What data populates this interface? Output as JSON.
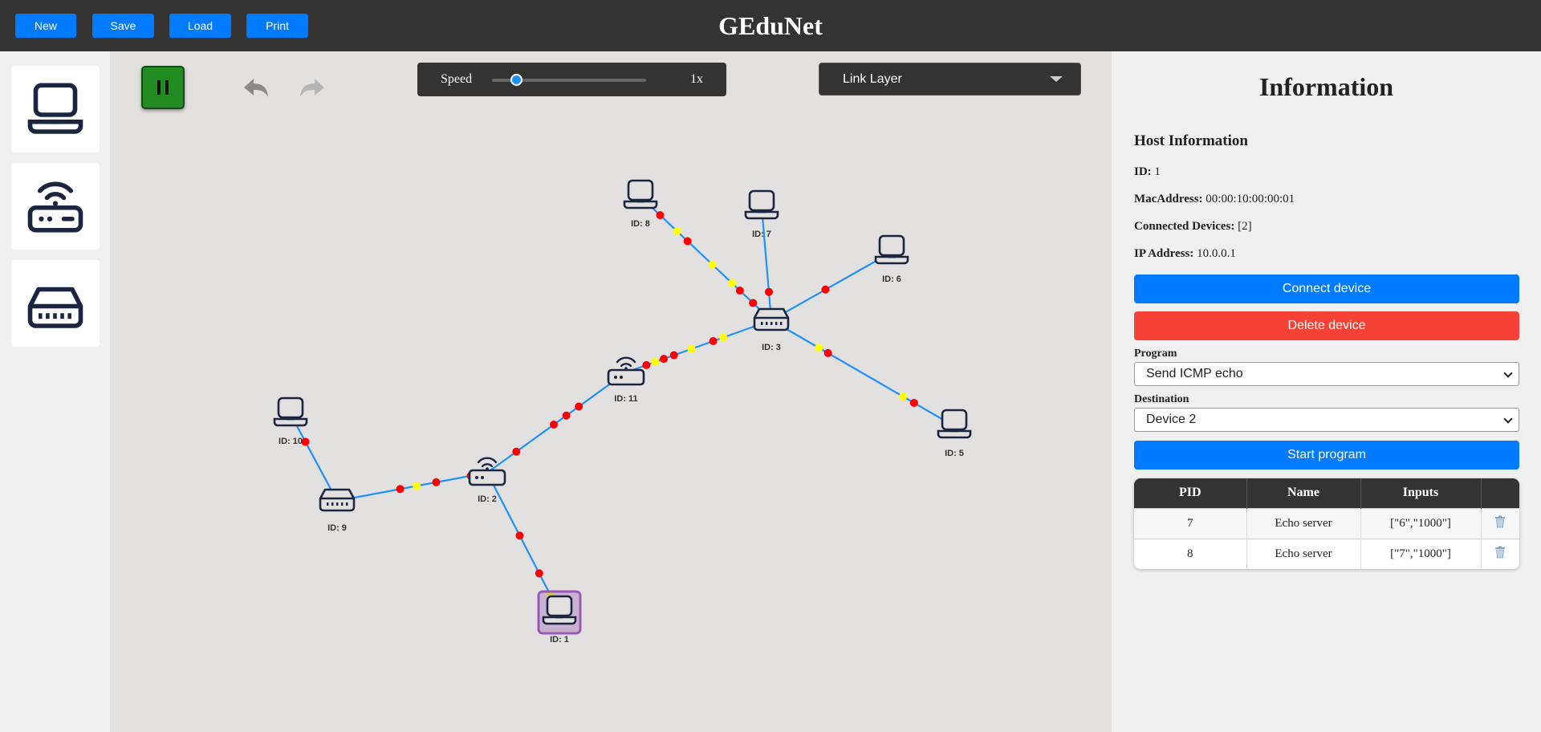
{
  "app": {
    "title": "GEduNet"
  },
  "toolbar": {
    "new_label": "New",
    "save_label": "Save",
    "load_label": "Load",
    "print_label": "Print"
  },
  "palette": {
    "items": [
      {
        "icon": "laptop-icon",
        "kind": "host"
      },
      {
        "icon": "router-icon",
        "kind": "router"
      },
      {
        "icon": "switch-icon",
        "kind": "switch"
      }
    ]
  },
  "controls": {
    "speed_label": "Speed",
    "speed_value": "1x",
    "layer_selected": "Link Layer",
    "pause_icon": "pause-icon",
    "undo_icon": "undo-icon",
    "redo_icon": "redo-icon"
  },
  "network": {
    "devices": [
      {
        "id": 1,
        "type": "host",
        "label": "ID: 1",
        "selected": true
      },
      {
        "id": 2,
        "type": "router",
        "label": "ID: 2"
      },
      {
        "id": 3,
        "type": "switch",
        "label": "ID: 3"
      },
      {
        "id": 5,
        "type": "host",
        "label": "ID: 5"
      },
      {
        "id": 6,
        "type": "host",
        "label": "ID: 6"
      },
      {
        "id": 7,
        "type": "host",
        "label": "ID: 7"
      },
      {
        "id": 8,
        "type": "host",
        "label": "ID: 8"
      },
      {
        "id": 9,
        "type": "switch",
        "label": "ID: 9"
      },
      {
        "id": 10,
        "type": "host",
        "label": "ID: 10"
      },
      {
        "id": 11,
        "type": "router",
        "label": "ID: 11"
      }
    ],
    "links": [
      [
        1,
        2
      ],
      [
        2,
        9
      ],
      [
        9,
        10
      ],
      [
        2,
        11
      ],
      [
        11,
        3
      ],
      [
        3,
        8
      ],
      [
        3,
        7
      ],
      [
        3,
        6
      ],
      [
        3,
        5
      ]
    ],
    "colors": {
      "link": "#1e90ff",
      "packet_red": "#ff0000",
      "packet_yellow": "#ffff00",
      "device": "#1c2540",
      "selected": "#9b59b6"
    }
  },
  "info": {
    "title": "Information",
    "section_title": "Host Information",
    "fields": [
      {
        "key": "ID:",
        "value": "1"
      },
      {
        "key": "MacAddress:",
        "value": "00:00:10:00:00:01"
      },
      {
        "key": "Connected Devices:",
        "value": "[2]"
      },
      {
        "key": "IP Address:",
        "value": "10.0.0.1"
      }
    ],
    "connect_label": "Connect device",
    "delete_label": "Delete device",
    "program_label": "Program",
    "program_selected": "Send ICMP echo",
    "destination_label": "Destination",
    "destination_selected": "Device 2",
    "start_label": "Start program",
    "table": {
      "headers": [
        "PID",
        "Name",
        "Inputs",
        ""
      ],
      "rows": [
        {
          "pid": "7",
          "name": "Echo server",
          "inputs": "[\"6\",\"1000\"]"
        },
        {
          "pid": "8",
          "name": "Echo server",
          "inputs": "[\"7\",\"1000\"]"
        }
      ],
      "delete_icon": "trash-icon"
    },
    "colors": {
      "primary": "#007bff",
      "danger": "#f44336"
    }
  }
}
